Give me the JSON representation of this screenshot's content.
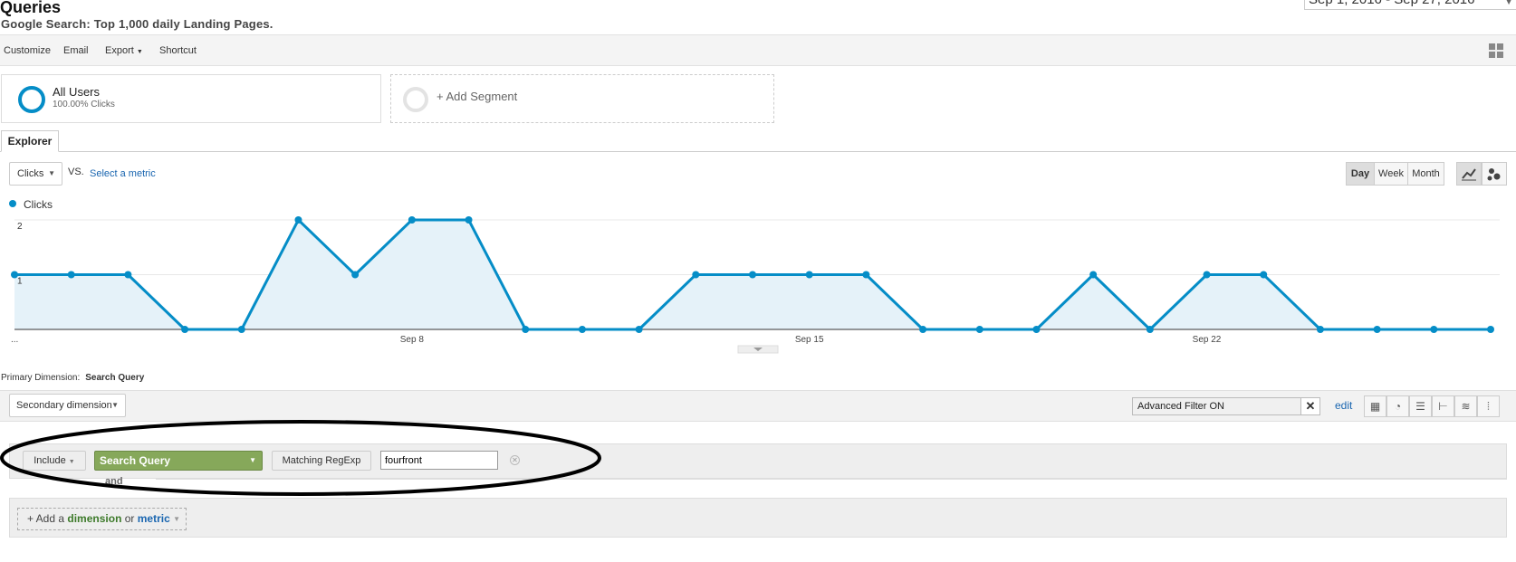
{
  "header": {
    "title": "Queries",
    "subtitle": "Google Search: Top 1,000 daily Landing Pages.",
    "date_range": "Sep 1, 2016 - Sep 27, 2016"
  },
  "toolbar": {
    "customize": "Customize",
    "email": "Email",
    "export": "Export",
    "shortcut": "Shortcut"
  },
  "segments": {
    "all_users_name": "All Users",
    "all_users_sub": "100.00% Clicks",
    "add_segment": "+ Add Segment"
  },
  "explorer": {
    "tab": "Explorer",
    "metric": "Clicks",
    "vs": "VS.",
    "select_metric": "Select a metric",
    "periods": [
      "Day",
      "Week",
      "Month"
    ],
    "active_period": "Day"
  },
  "chart_data": {
    "type": "area",
    "series": [
      {
        "name": "Clicks",
        "color": "#058dc7",
        "values": [
          1,
          1,
          1,
          0,
          0,
          2,
          1,
          2,
          2,
          0,
          0,
          0,
          1,
          1,
          1,
          1,
          0,
          0,
          0,
          1,
          0,
          1,
          1,
          0,
          0,
          0,
          0
        ]
      }
    ],
    "x_tick_labels": [
      "...",
      "Sep 8",
      "Sep 15",
      "Sep 22"
    ],
    "y_tick_labels": [
      "1",
      "2"
    ],
    "ylim": [
      0,
      2
    ],
    "grid": true
  },
  "table_controls": {
    "primary_dimension_label": "Primary Dimension:",
    "primary_dimension_value": "Search Query",
    "secondary_dimension": "Secondary dimension",
    "advanced_filter": "Advanced Filter ON",
    "edit": "edit"
  },
  "filter": {
    "include": "Include",
    "dimension": "Search Query",
    "match_type": "Matching RegExp",
    "value": "fourfront",
    "and_label": "and",
    "add_prefix": "+ Add a",
    "add_dimension": "dimension",
    "add_or": "or",
    "add_metric": "metric"
  }
}
